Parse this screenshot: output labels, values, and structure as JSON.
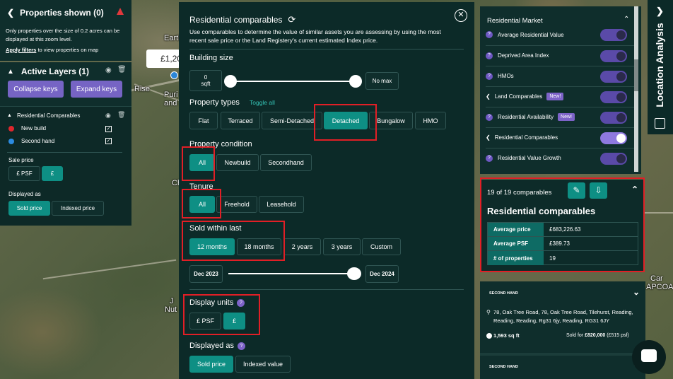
{
  "map": {
    "price_tag": "£1,20",
    "labels": [
      "Earth",
      "Rise",
      "Puri",
      "and Sc",
      "Ch",
      "J",
      "Nut",
      "Car",
      "APCOA"
    ]
  },
  "properties_panel": {
    "title": "Properties shown (0)",
    "message": "Only properties over the size of 0.2 acres can be displayed at this zoom level.",
    "apply_link": "Apply filters",
    "apply_suffix": "to view properties on map"
  },
  "layers_panel": {
    "title": "Active Layers (1)",
    "collapse": "Collapse keys",
    "expand": "Expand keys",
    "layer_name": "Residential Comparables",
    "legend": [
      {
        "label": "New build",
        "color": "#e0272d"
      },
      {
        "label": "Second hand",
        "color": "#2c8be0"
      }
    ],
    "sale_price_label": "Sale price",
    "sale_price_options": [
      "£ PSF",
      "£"
    ],
    "displayed_as_label": "Displayed as",
    "displayed_as_options": [
      "Sold price",
      "Indexed price"
    ]
  },
  "modal": {
    "title": "Residential comparables",
    "description": "Use comparables to determine the value of similar assets you are assessing by using the most recent sale price or the Land Registery's current estimated Index price.",
    "building_size": {
      "label": "Building size",
      "min_value": "0",
      "min_unit": "sqft",
      "max": "No max"
    },
    "property_types": {
      "label": "Property types",
      "toggle": "Toggle all",
      "options": [
        "Flat",
        "Terraced",
        "Semi-Detached",
        "Detached",
        "Bungalow",
        "HMO"
      ],
      "selected": "Detached"
    },
    "property_condition": {
      "label": "Property condition",
      "options": [
        "All",
        "Newbuild",
        "Secondhand"
      ],
      "selected": "All"
    },
    "tenure": {
      "label": "Tenure",
      "options": [
        "All",
        "Freehold",
        "Leasehold"
      ],
      "selected": "All"
    },
    "sold_within": {
      "label": "Sold within last",
      "options": [
        "12 months",
        "18 months",
        "2 years",
        "3 years",
        "Custom"
      ],
      "selected": "12 months"
    },
    "date_range": {
      "from": "Dec 2023",
      "to": "Dec 2024"
    },
    "display_units": {
      "label": "Display units",
      "options": [
        "£ PSF",
        "£"
      ],
      "selected": "£"
    },
    "displayed_as": {
      "label": "Displayed as",
      "options": [
        "Sold price",
        "Indexed value"
      ],
      "selected": "Sold price"
    }
  },
  "market": {
    "title": "Residential Market",
    "rows": [
      {
        "label": "Average Residential Value",
        "on": false,
        "new": false,
        "chevron": false
      },
      {
        "label": "Deprived Area Index",
        "on": false,
        "new": false,
        "chevron": false
      },
      {
        "label": "HMOs",
        "on": false,
        "new": false,
        "chevron": false
      },
      {
        "label": "Land Comparables",
        "on": false,
        "new": true,
        "chevron": true
      },
      {
        "label": "Residential Availability",
        "on": false,
        "new": true,
        "chevron": false
      },
      {
        "label": "Residential Comparables",
        "on": true,
        "new": false,
        "chevron": true
      },
      {
        "label": "Residential Value Growth",
        "on": false,
        "new": false,
        "chevron": false
      }
    ],
    "new_badge": "New!"
  },
  "side_tab": {
    "label": "Location Analysis"
  },
  "comparables": {
    "count_text": "19 of 19 comparables",
    "title": "Residential comparables",
    "rows": [
      {
        "key": "Average price",
        "value": "£683,226.63"
      },
      {
        "key": "Average PSF",
        "value": "£389.73"
      },
      {
        "key": "# of properties",
        "value": "19"
      }
    ]
  },
  "listings": [
    {
      "tag": "SECOND HAND",
      "address": "78, Oak Tree Road, 78, Oak Tree Road, Tilehurst, Reading, Reading, Reading, Rg31 6jy, Reading, RG31 6JY",
      "size": "1,593 sq ft",
      "sold_prefix": "Sold for ",
      "sold_price": "£820,000",
      "sold_psf": " (£515 psf)"
    },
    {
      "tag": "SECOND HAND"
    }
  ]
}
